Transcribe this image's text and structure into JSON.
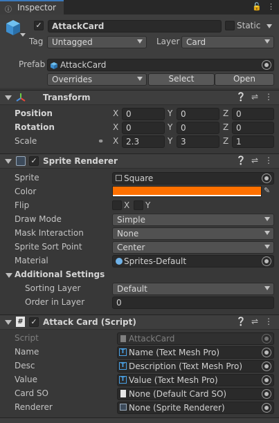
{
  "tab": {
    "icon": "info-icon",
    "label": "Inspector",
    "icons": [
      "lock-icon",
      "more-menu-icon"
    ]
  },
  "object": {
    "active_checked": true,
    "name": "AttackCard",
    "static_label": "Static",
    "static_checked": false,
    "tag_label": "Tag",
    "tag_value": "Untagged",
    "layer_label": "Layer",
    "layer_value": "Card",
    "prefab_label": "Prefab",
    "prefab_value": "AttackCard",
    "overrides_label": "Overrides",
    "select_label": "Select",
    "open_label": "Open"
  },
  "transform": {
    "title": "Transform",
    "rows": [
      {
        "label": "Position",
        "x": "0",
        "y": "0",
        "z": "0"
      },
      {
        "label": "Rotation",
        "x": "0",
        "y": "0",
        "z": "0"
      },
      {
        "label": "Scale",
        "x": "2.3",
        "y": "3",
        "z": "1"
      }
    ],
    "axis_x": "X",
    "axis_y": "Y",
    "axis_z": "Z"
  },
  "sprite_renderer": {
    "title": "Sprite Renderer",
    "enabled": true,
    "sprite_label": "Sprite",
    "sprite_value": "Square",
    "color_label": "Color",
    "color_value": "#ff7000",
    "flip_label": "Flip",
    "flip_x": "X",
    "flip_y": "Y",
    "draw_mode_label": "Draw Mode",
    "draw_mode_value": "Simple",
    "mask_label": "Mask Interaction",
    "mask_value": "None",
    "sort_point_label": "Sprite Sort Point",
    "sort_point_value": "Center",
    "material_label": "Material",
    "material_value": "Sprites-Default",
    "additional_label": "Additional Settings",
    "sorting_layer_label": "Sorting Layer",
    "sorting_layer_value": "Default",
    "order_label": "Order in Layer",
    "order_value": "0"
  },
  "attack_card": {
    "title": "Attack Card (Script)",
    "enabled": true,
    "script_label": "Script",
    "script_value": "AttackCard",
    "fields": [
      {
        "label": "Name",
        "value": "Name (Text Mesh Pro)"
      },
      {
        "label": "Desc",
        "value": "Description (Text Mesh Pro)"
      },
      {
        "label": "Value",
        "value": "Value (Text Mesh Pro)"
      },
      {
        "label": "Card SO",
        "value": "None (Default Card SO)"
      },
      {
        "label": "Renderer",
        "value": "None (Sprite Renderer)"
      }
    ]
  },
  "colors": {
    "accent": "#3a79bb",
    "background": "#383838",
    "header": "#3e3e3e",
    "field": "#2a2a2a",
    "tmp_icon": "#4aa3e8"
  }
}
